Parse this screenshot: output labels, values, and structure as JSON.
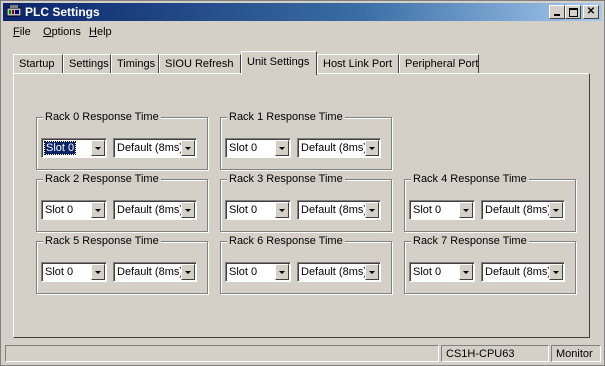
{
  "window": {
    "title": "PLC Settings"
  },
  "menu": [
    {
      "label": "File",
      "accel": "F",
      "rest": "ile"
    },
    {
      "label": "Options",
      "accel": "O",
      "rest": "ptions"
    },
    {
      "label": "Help",
      "accel": "H",
      "rest": "elp"
    }
  ],
  "tabs": [
    "Startup",
    "Settings",
    "Timings",
    "SIOU Refresh",
    "Unit Settings",
    "Host Link Port",
    "Peripheral Port"
  ],
  "active_tab": "Unit Settings",
  "groups": [
    {
      "label": "Rack 0 Response Time",
      "slot": "Slot 0",
      "time": "Default (8ms)"
    },
    {
      "label": "Rack 1 Response Time",
      "slot": "Slot 0",
      "time": "Default (8ms)"
    },
    {
      "label": "Rack 2 Response Time",
      "slot": "Slot 0",
      "time": "Default (8ms)"
    },
    {
      "label": "Rack 3 Response Time",
      "slot": "Slot 0",
      "time": "Default (8ms)"
    },
    {
      "label": "Rack 4 Response Time",
      "slot": "Slot 0",
      "time": "Default (8ms)"
    },
    {
      "label": "Rack 5 Response Time",
      "slot": "Slot 0",
      "time": "Default (8ms)"
    },
    {
      "label": "Rack 6 Response Time",
      "slot": "Slot 0",
      "time": "Default (8ms)"
    },
    {
      "label": "Rack 7 Response Time",
      "slot": "Slot 0",
      "time": "Default (8ms)"
    }
  ],
  "status": {
    "model": "CS1H-CPU63",
    "mode": "Monitor"
  },
  "colors": {
    "title_start": "#0a246a",
    "title_end": "#a6caf0",
    "face": "#d4d0c8",
    "selection": "#0a246a"
  }
}
